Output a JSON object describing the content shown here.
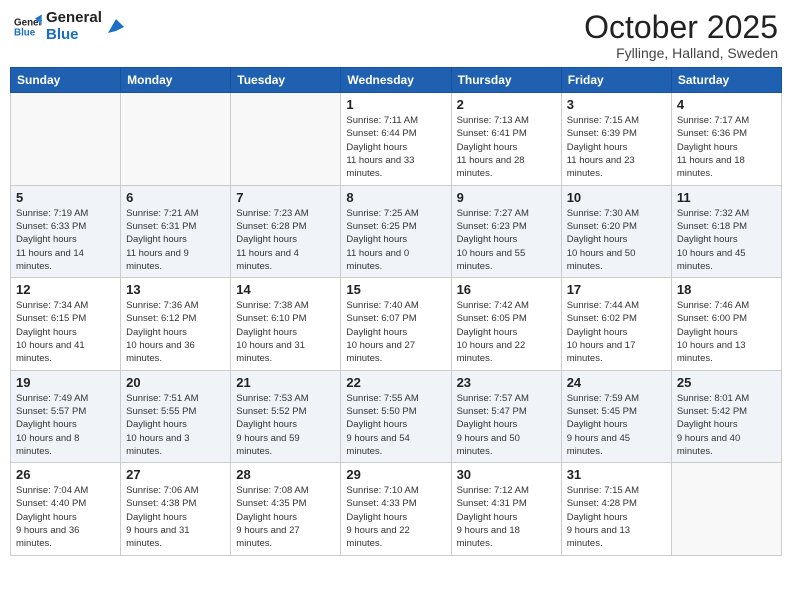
{
  "header": {
    "logo_line1": "General",
    "logo_line2": "Blue",
    "month": "October 2025",
    "location": "Fyllinge, Halland, Sweden"
  },
  "days_of_week": [
    "Sunday",
    "Monday",
    "Tuesday",
    "Wednesday",
    "Thursday",
    "Friday",
    "Saturday"
  ],
  "weeks": [
    [
      {
        "num": "",
        "empty": true
      },
      {
        "num": "",
        "empty": true
      },
      {
        "num": "",
        "empty": true
      },
      {
        "num": "1",
        "sunrise": "7:11 AM",
        "sunset": "6:44 PM",
        "daylight": "11 hours and 33 minutes."
      },
      {
        "num": "2",
        "sunrise": "7:13 AM",
        "sunset": "6:41 PM",
        "daylight": "11 hours and 28 minutes."
      },
      {
        "num": "3",
        "sunrise": "7:15 AM",
        "sunset": "6:39 PM",
        "daylight": "11 hours and 23 minutes."
      },
      {
        "num": "4",
        "sunrise": "7:17 AM",
        "sunset": "6:36 PM",
        "daylight": "11 hours and 18 minutes."
      }
    ],
    [
      {
        "num": "5",
        "sunrise": "7:19 AM",
        "sunset": "6:33 PM",
        "daylight": "11 hours and 14 minutes."
      },
      {
        "num": "6",
        "sunrise": "7:21 AM",
        "sunset": "6:31 PM",
        "daylight": "11 hours and 9 minutes."
      },
      {
        "num": "7",
        "sunrise": "7:23 AM",
        "sunset": "6:28 PM",
        "daylight": "11 hours and 4 minutes."
      },
      {
        "num": "8",
        "sunrise": "7:25 AM",
        "sunset": "6:25 PM",
        "daylight": "11 hours and 0 minutes."
      },
      {
        "num": "9",
        "sunrise": "7:27 AM",
        "sunset": "6:23 PM",
        "daylight": "10 hours and 55 minutes."
      },
      {
        "num": "10",
        "sunrise": "7:30 AM",
        "sunset": "6:20 PM",
        "daylight": "10 hours and 50 minutes."
      },
      {
        "num": "11",
        "sunrise": "7:32 AM",
        "sunset": "6:18 PM",
        "daylight": "10 hours and 45 minutes."
      }
    ],
    [
      {
        "num": "12",
        "sunrise": "7:34 AM",
        "sunset": "6:15 PM",
        "daylight": "10 hours and 41 minutes."
      },
      {
        "num": "13",
        "sunrise": "7:36 AM",
        "sunset": "6:12 PM",
        "daylight": "10 hours and 36 minutes."
      },
      {
        "num": "14",
        "sunrise": "7:38 AM",
        "sunset": "6:10 PM",
        "daylight": "10 hours and 31 minutes."
      },
      {
        "num": "15",
        "sunrise": "7:40 AM",
        "sunset": "6:07 PM",
        "daylight": "10 hours and 27 minutes."
      },
      {
        "num": "16",
        "sunrise": "7:42 AM",
        "sunset": "6:05 PM",
        "daylight": "10 hours and 22 minutes."
      },
      {
        "num": "17",
        "sunrise": "7:44 AM",
        "sunset": "6:02 PM",
        "daylight": "10 hours and 17 minutes."
      },
      {
        "num": "18",
        "sunrise": "7:46 AM",
        "sunset": "6:00 PM",
        "daylight": "10 hours and 13 minutes."
      }
    ],
    [
      {
        "num": "19",
        "sunrise": "7:49 AM",
        "sunset": "5:57 PM",
        "daylight": "10 hours and 8 minutes."
      },
      {
        "num": "20",
        "sunrise": "7:51 AM",
        "sunset": "5:55 PM",
        "daylight": "10 hours and 3 minutes."
      },
      {
        "num": "21",
        "sunrise": "7:53 AM",
        "sunset": "5:52 PM",
        "daylight": "9 hours and 59 minutes."
      },
      {
        "num": "22",
        "sunrise": "7:55 AM",
        "sunset": "5:50 PM",
        "daylight": "9 hours and 54 minutes."
      },
      {
        "num": "23",
        "sunrise": "7:57 AM",
        "sunset": "5:47 PM",
        "daylight": "9 hours and 50 minutes."
      },
      {
        "num": "24",
        "sunrise": "7:59 AM",
        "sunset": "5:45 PM",
        "daylight": "9 hours and 45 minutes."
      },
      {
        "num": "25",
        "sunrise": "8:01 AM",
        "sunset": "5:42 PM",
        "daylight": "9 hours and 40 minutes."
      }
    ],
    [
      {
        "num": "26",
        "sunrise": "7:04 AM",
        "sunset": "4:40 PM",
        "daylight": "9 hours and 36 minutes."
      },
      {
        "num": "27",
        "sunrise": "7:06 AM",
        "sunset": "4:38 PM",
        "daylight": "9 hours and 31 minutes."
      },
      {
        "num": "28",
        "sunrise": "7:08 AM",
        "sunset": "4:35 PM",
        "daylight": "9 hours and 27 minutes."
      },
      {
        "num": "29",
        "sunrise": "7:10 AM",
        "sunset": "4:33 PM",
        "daylight": "9 hours and 22 minutes."
      },
      {
        "num": "30",
        "sunrise": "7:12 AM",
        "sunset": "4:31 PM",
        "daylight": "9 hours and 18 minutes."
      },
      {
        "num": "31",
        "sunrise": "7:15 AM",
        "sunset": "4:28 PM",
        "daylight": "9 hours and 13 minutes."
      },
      {
        "num": "",
        "empty": true
      }
    ]
  ],
  "labels": {
    "sunrise": "Sunrise: ",
    "sunset": "Sunset: ",
    "daylight": "Daylight hours"
  }
}
